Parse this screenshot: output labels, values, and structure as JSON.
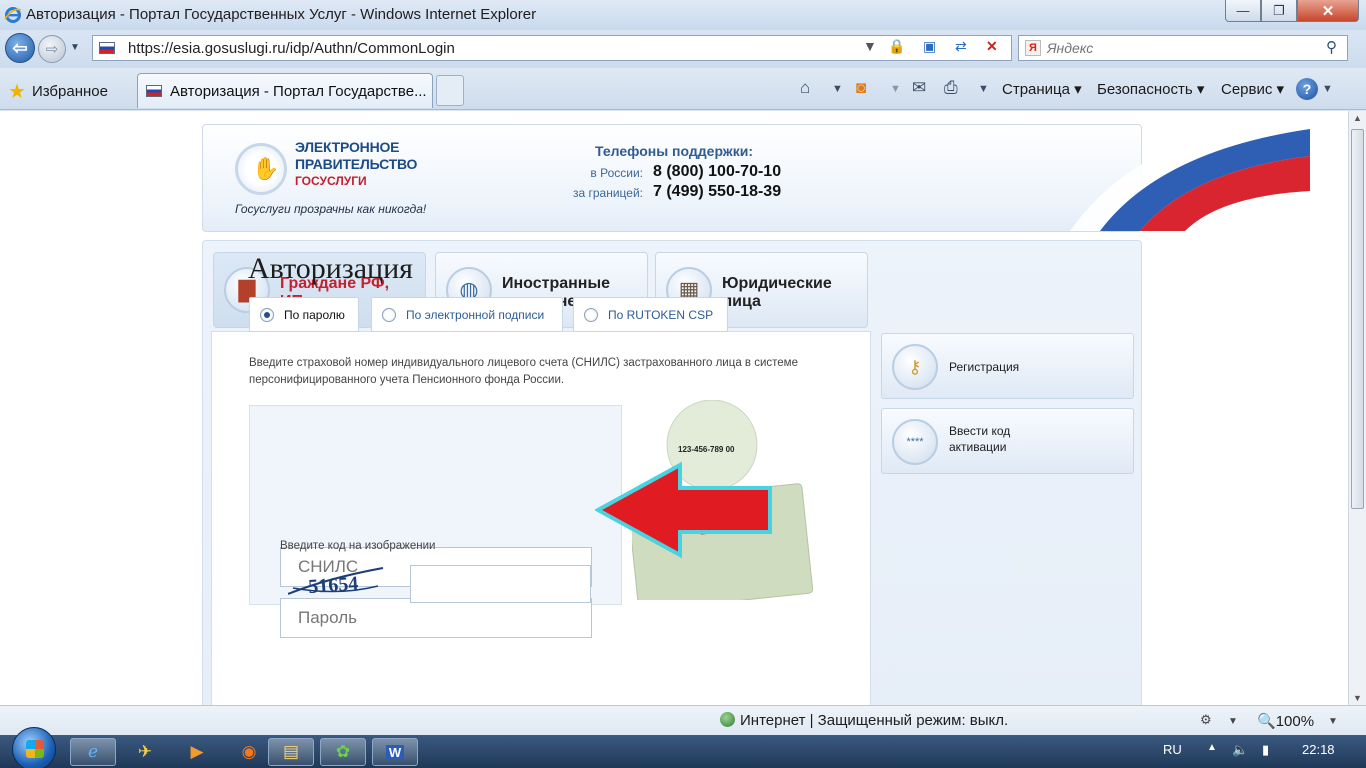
{
  "window": {
    "title": "Авторизация - Портал Государственных Услуг - Windows Internet Explorer",
    "min": "—",
    "max": "❐",
    "close": "✕"
  },
  "addressbar": {
    "url": "https://esia.gosuslugi.ru/idp/Authn/CommonLogin",
    "search_placeholder": "Яндекс",
    "search_engine_badge": "Я"
  },
  "commandbar": {
    "favorites": "Избранное",
    "tab_title": "Авторизация - Портал Государстве...",
    "page": "Страница ▾",
    "security": "Безопасность ▾",
    "service": "Сервис ▾",
    "help": "?"
  },
  "header": {
    "logo_line1": "ЭЛЕКТРОННОЕ",
    "logo_line2": "ПРАВИТЕЛЬСТВО",
    "logo_line3": "ГОСУСЛУГИ",
    "slogan": "Госуслуги прозрачны как никогда!",
    "support_title": "Телефоны поддержки:",
    "russia_label": "в России:",
    "russia_phone": "8 (800) 100-70-10",
    "abroad_label": "за границей:",
    "abroad_phone": "7 (499) 550-18-39"
  },
  "category_tabs": [
    {
      "label1": "Граждане РФ,",
      "label2": "ИП",
      "active": true
    },
    {
      "label1": "Иностранные",
      "label2": "граждане",
      "active": false
    },
    {
      "label1": "Юридические",
      "label2": "лица",
      "active": false
    }
  ],
  "auth": {
    "title": "Авторизация",
    "methods": [
      "По паролю",
      "По электронной подписи",
      "По RUTOKEN CSP"
    ],
    "selected_method": "По паролю",
    "hint": "Введите страховой номер индивидуального лицевого счета (СНИЛС) застрахованного лица в системе персонифицированного учета Пенсионного фонда России.",
    "snils_placeholder": "СНИЛС",
    "password_placeholder": "Пароль",
    "captcha_label": "Введите код на изображении",
    "captcha_code": "51654",
    "card_number": "123-456-789 00"
  },
  "sidebar": {
    "registration": "Регистрация",
    "activation_line1": "Ввести код",
    "activation_line2": "активации",
    "activation_icon_text": "****"
  },
  "statusbar": {
    "zone": "Интернет | Защищенный режим: выкл.",
    "zoom": "100%"
  },
  "taskbar": {
    "lang": "RU",
    "clock": "22:18"
  }
}
